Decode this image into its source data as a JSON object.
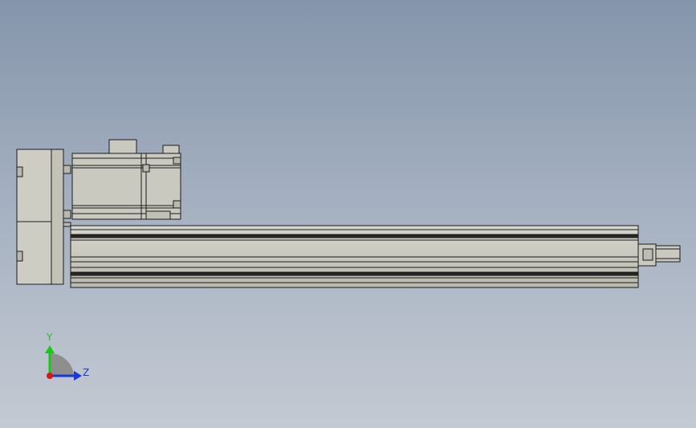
{
  "viewport": {
    "background_top": "#8595ab",
    "background_bottom": "#c4cad3"
  },
  "model": {
    "part_color": "#c9c9bf",
    "part_shade": "#a9a99e",
    "edge_color": "#1c1c1c"
  },
  "triad": {
    "y_label": "Y",
    "z_label": "Z",
    "y_color": "#18c818",
    "z_color": "#1838d8",
    "x_color": "#d81818"
  }
}
